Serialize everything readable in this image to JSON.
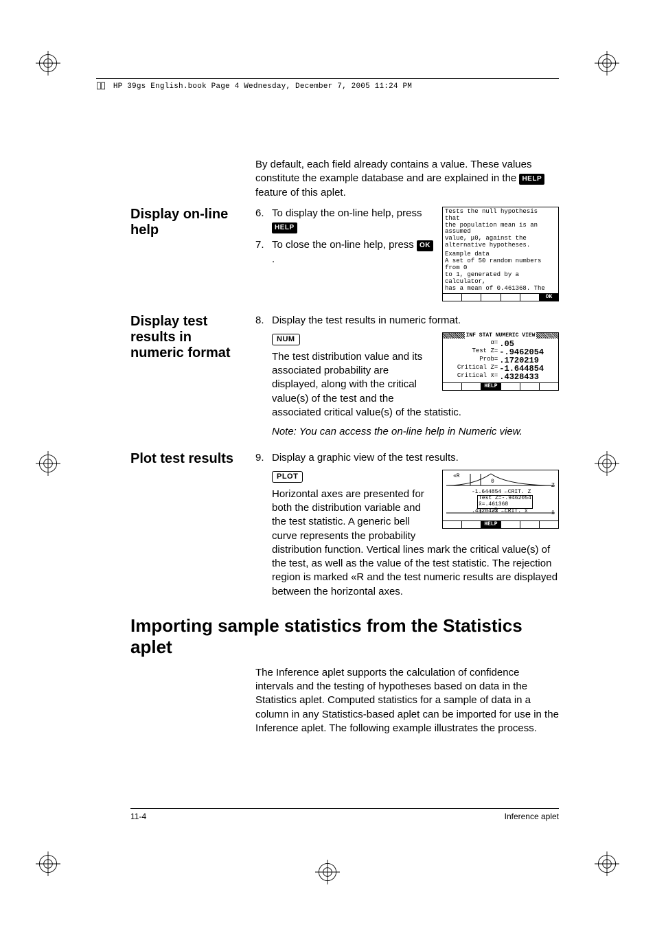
{
  "header": {
    "text": "HP 39gs English.book  Page 4  Wednesday, December 7, 2005  11:24 PM"
  },
  "intro": "By default, each field already contains a value. These values constitute the example database and are explained in the ",
  "intro_tail": " feature of this aplet.",
  "help_key": "HELP",
  "ok_key": "OK",
  "num_key": "NUM",
  "plot_key": "PLOT",
  "sections": {
    "help": {
      "label": "Display on-line help",
      "step6_a": "To display the on-line help, press ",
      "step7_a": "To close the on-line help, press ",
      "step7_b": " ."
    },
    "numeric": {
      "label": "Display test results in numeric format",
      "step8": "Display the test results in numeric format.",
      "para": "The test distribution value and its associated probability are displayed, along with the critical value(s) of the test and the associated critical value(s) of the statistic.",
      "note": "Note: You can access the on-line help in Numeric view."
    },
    "plot": {
      "label": "Plot test results",
      "step9": "Display a graphic view of the test results.",
      "para_a": "Horizontal axes are presented for both the distribution variable and the test statistic. A generic bell curve represents the probability distribution function. Vertical lines mark the critical value(s) of the test, as well as the value of the test statistic. The rejection region is marked ",
      "reject_symbol": "«R",
      "para_b": " and the test numeric results are displayed between the horizontal axes."
    }
  },
  "h1": "Importing sample statistics from the Statistics aplet",
  "import_para": "The Inference aplet supports the calculation of confidence intervals and the testing of hypotheses based on data in the Statistics aplet. Computed statistics for a sample of data in a column in any Statistics-based aplet can be imported for use in the Inference aplet. The following example illustrates the process.",
  "footer": {
    "left": "11-4",
    "right": "Inference aplet"
  },
  "screen1": {
    "l1": "Tests the null hypothesis that",
    "l2": "the population mean is an assumed",
    "l3": "value, μ0, against the",
    "l4": "alternative hypotheses.",
    "l5": "Example data",
    "l6": "A set of 50 random numbers from 0",
    "l7": "to 1, generated by a calculator,",
    "l8": "has a mean of 0.461368. The",
    "ok": "OK"
  },
  "screen2": {
    "title": "INF STAT NUMERIC VIEW",
    "r1a": "α=",
    "r1b": ".05",
    "r2a": "Test  Z=",
    "r2b": "-.9462054",
    "r3a": "Prob=",
    "r3b": ".1720219",
    "r4a": "Critical Z=",
    "r4b": "-1.644854",
    "r5a": "Critical x̄=",
    "r5b": ".4328433",
    "help": "HELP"
  },
  "screen3": {
    "l1": "-1.644854 ←CRIT. Z",
    "l2": "Test Z=-.9462054",
    "l3": "x̄=.461368",
    "l4": ".4328433 ←CRIT. x̄",
    "help": "HELP"
  }
}
